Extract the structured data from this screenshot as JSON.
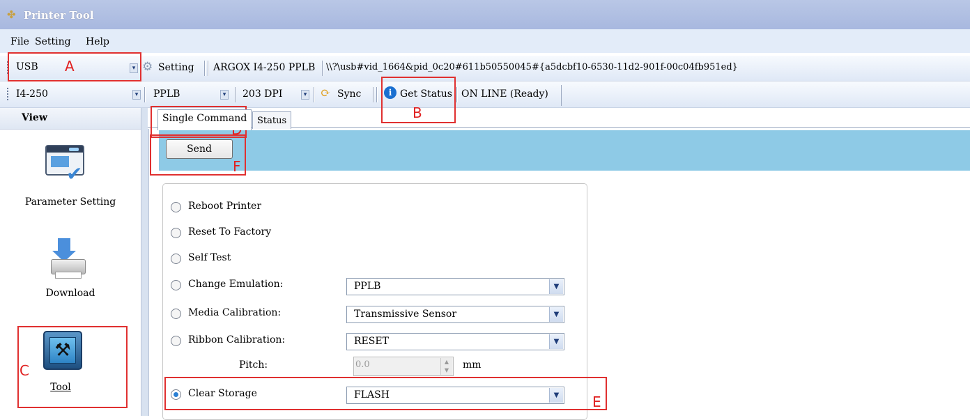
{
  "window": {
    "title": "Printer Tool"
  },
  "menu": [
    "File",
    "Setting",
    "Help"
  ],
  "toolbar1": {
    "port": "USB",
    "setting_label": "Setting",
    "model_name": "ARGOX I4-250 PPLB",
    "device_path": "\\\\?\\usb#vid_1664&pid_0c20#611b50550045#{a5dcbf10-6530-11d2-901f-00c04fb951ed}"
  },
  "toolbar2": {
    "model": "I4-250",
    "emulation": "PPLB",
    "dpi": "203 DPI",
    "sync_label": "Sync",
    "get_status_label": "Get Status",
    "status_text": "ON LINE (Ready)"
  },
  "view": {
    "header": "View",
    "items": [
      "Parameter Setting",
      "Download",
      "Tool"
    ]
  },
  "tabs": [
    "Single Command",
    "Status"
  ],
  "send_label": "Send",
  "options": [
    {
      "label": "Reboot Printer"
    },
    {
      "label": "Reset To Factory"
    },
    {
      "label": "Self Test"
    },
    {
      "label": "Change Emulation:",
      "value": "PPLB"
    },
    {
      "label": "Media Calibration:",
      "value": "Transmissive Sensor"
    },
    {
      "label": "Ribbon Calibration:",
      "value": "RESET"
    },
    {
      "label": "Clear Storage",
      "value": "FLASH",
      "checked": true
    }
  ],
  "pitch": {
    "label": "Pitch:",
    "value": "0.0",
    "unit": "mm"
  },
  "annotations": [
    "A",
    "B",
    "C",
    "D",
    "E",
    "F"
  ],
  "colors": {
    "annotation": "#e03030",
    "command_bar": "#8ecae6",
    "radio_checked": "#2a7fd4"
  }
}
